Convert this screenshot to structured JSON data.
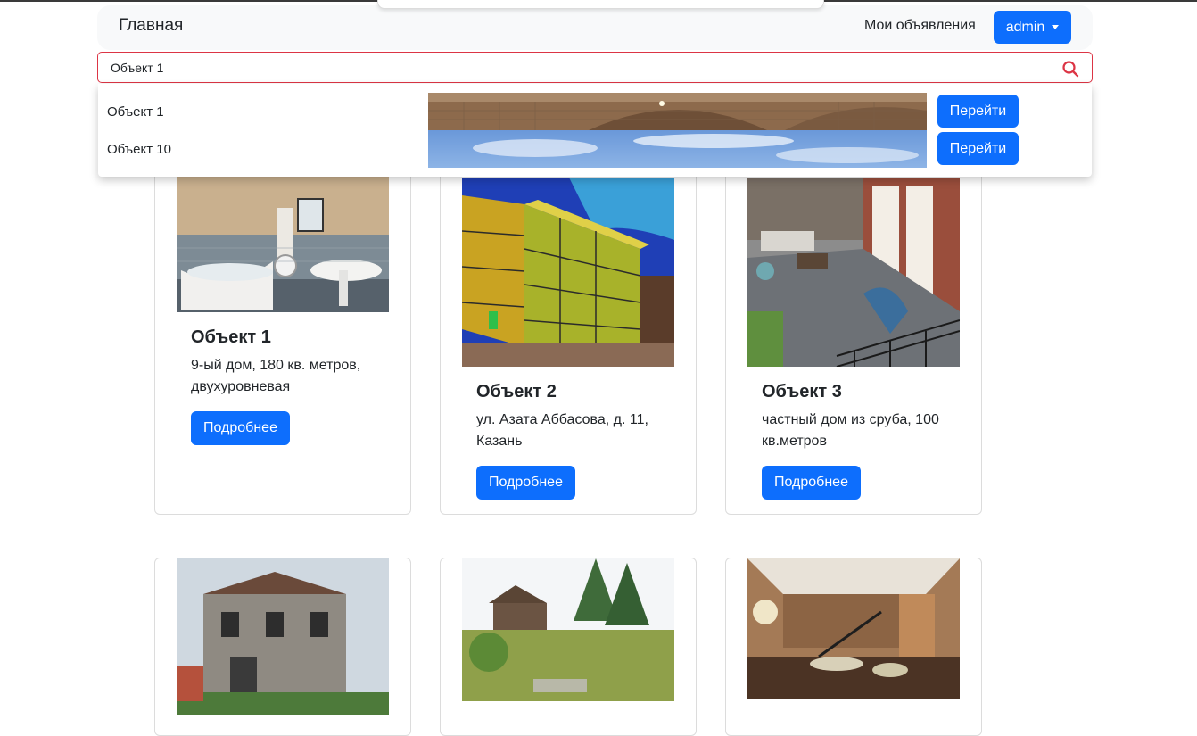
{
  "navbar": {
    "brand": "Главная",
    "my_ads": "Мои объявления",
    "user": "admin"
  },
  "search": {
    "value": "Объект 1"
  },
  "suggestions": [
    {
      "label": "Объект 1",
      "button": "Перейти"
    },
    {
      "label": "Объект 10",
      "button": "Перейти"
    }
  ],
  "cards": [
    {
      "title": "Объект 1",
      "text": "9-ый дом, 180 кв. метров, двухуровневая",
      "button": "Подробнее"
    },
    {
      "title": "Объект 2",
      "text": "ул. Азата Аббасова, д. 11, Казань",
      "button": "Подробнее"
    },
    {
      "title": "Объект 3",
      "text": "частный дом из сруба, 100 кв.метров",
      "button": "Подробнее"
    }
  ],
  "colors": {
    "primary": "#0d6efd",
    "danger": "#dc3545",
    "navbar_bg": "#f8f9fa"
  }
}
